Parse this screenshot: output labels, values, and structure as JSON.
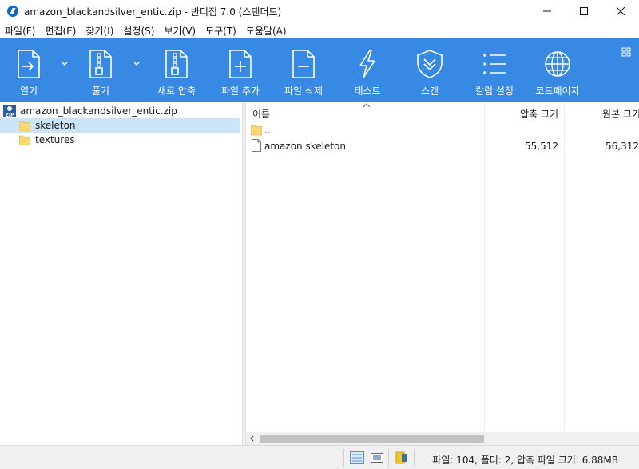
{
  "window": {
    "title": "amazon_blackandsilver_entic.zip - 반디집 7.0 (스탠더드)"
  },
  "menu": [
    "파일(F)",
    "편집(E)",
    "찾기(I)",
    "설정(S)",
    "보기(V)",
    "도구(T)",
    "도움말(A)"
  ],
  "toolbar": {
    "open": "열기",
    "extract": "풀기",
    "new_archive": "새로 압축",
    "add_file": "파일 추가",
    "delete_file": "파일 삭제",
    "test": "테스트",
    "scan": "스캔",
    "column_settings": "칼럼 설정",
    "codepage": "코드페이지"
  },
  "tree": {
    "root": "amazon_blackandsilver_entic.zip",
    "items": [
      "skeleton",
      "textures"
    ],
    "selected": "skeleton"
  },
  "list": {
    "columns": {
      "name": "이름",
      "compressed": "압축 크기",
      "original": "원본 크기"
    },
    "rows": [
      {
        "name": "..",
        "compressed": "",
        "original": "",
        "type": "folder"
      },
      {
        "name": "amazon.skeleton",
        "compressed": "55,512",
        "original": "56,312",
        "type": "file"
      }
    ]
  },
  "status": {
    "text": "파일: 104, 폴더: 2, 압축 파일 크기: 6.88MB"
  },
  "colors": {
    "toolbar": "#3789e4",
    "selection": "#cce4f7"
  }
}
